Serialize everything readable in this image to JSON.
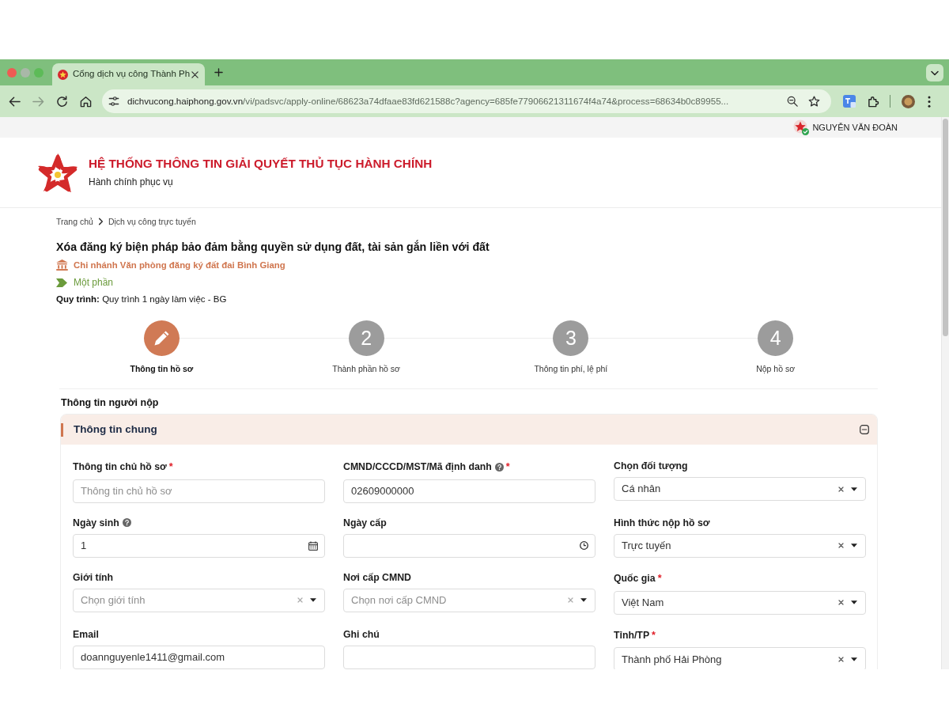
{
  "browser": {
    "tabs": [
      {
        "title": "Cổng dịch vụ công Thành Ph",
        "selected": true
      }
    ],
    "address": {
      "host": "dichvucong.haiphong.gov.vn",
      "path": "/vi/padsvc/apply-online/68623a74dfaae83fd621588c?agency=685fe77906621311674f4a74&process=68634b0c89955..."
    }
  },
  "user_bar": {
    "user_name": "NGUYỄN VĂN ĐOÀN"
  },
  "header": {
    "title": "HỆ THỐNG THÔNG TIN GIẢI QUYẾT THỦ TỤC HÀNH CHÍNH",
    "subtitle": "Hành chính phục vụ"
  },
  "breadcrumb": [
    {
      "label": "Trang chủ"
    },
    {
      "label": "Dịch vụ công trực tuyến"
    }
  ],
  "procedure": {
    "title": "Xóa đăng ký biện pháp bảo đảm bằng quyền sử dụng đất, tài sản gắn liền với đất",
    "agency": "Chi nhánh Văn phòng đăng ký đất đai Bình Giang",
    "level": "Một phần",
    "process": "**Quy trình:** Quy trình 1 ngày làm việc - BG"
  },
  "steps": [
    {
      "label": "Thông tin hồ sơ",
      "selected": true
    },
    {
      "number": "2",
      "label": "Thành phần hồ sơ",
      "selected": false
    },
    {
      "number": "3",
      "label": "Thông tin phí, lệ phí",
      "selected": false
    },
    {
      "number": "4",
      "label": "Nộp hồ sơ",
      "selected": false
    }
  ],
  "section_title": "Thông tin người nộp",
  "panel": {
    "title": "Thông tin chung",
    "expanded": true,
    "fields": [
      {
        "kind": "text",
        "label": "Thông tin chủ hồ sơ",
        "help": false,
        "required_mark": "*",
        "placeholder": "Thông tin chủ hồ sơ"
      },
      {
        "kind": "text",
        "label": "CMND/CCCD/MST/Mã định danh",
        "help": true,
        "required_mark": "*",
        "value": "02609000000"
      },
      {
        "kind": "select",
        "label": "Chọn đối tượng",
        "help": false,
        "value": "Cá nhân"
      },
      {
        "kind": "date",
        "label": "Ngày sinh",
        "help": true,
        "value": "1"
      },
      {
        "kind": "time",
        "label": "Ngày cấp",
        "help": false
      },
      {
        "kind": "select",
        "label": "Hình thức nộp hồ sơ",
        "help": false,
        "value": "Trực tuyến"
      },
      {
        "kind": "select",
        "label": "Giới tính",
        "help": false,
        "placeholder": "Chọn giới tính"
      },
      {
        "kind": "select",
        "label": "Nơi cấp CMND",
        "help": false,
        "placeholder": "Chọn nơi cấp CMND"
      },
      {
        "kind": "select",
        "label": "Quốc gia",
        "help": false,
        "required_mark": "*",
        "value": "Việt Nam"
      },
      {
        "kind": "text",
        "label": "Email",
        "help": false,
        "value": "doannguyenle1411@gmail.com"
      },
      {
        "kind": "text",
        "label": "Ghi chú",
        "help": false
      },
      {
        "kind": "select",
        "label": "Tỉnh/TP",
        "help": false,
        "required_mark": "*",
        "value": "Thành phố Hải Phòng"
      }
    ]
  }
}
